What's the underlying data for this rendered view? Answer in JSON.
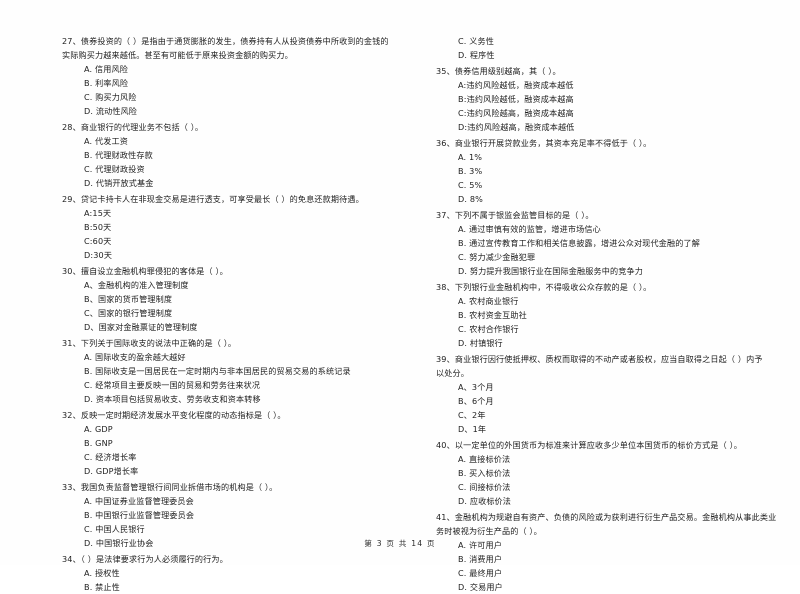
{
  "document": {
    "footer": "第 3 页 共 14 页",
    "page_number": "3",
    "total_pages": "14"
  },
  "columns": [
    {
      "name": "left-column",
      "questions": [
        {
          "number": "27",
          "stem": "27、债券投资的（      ）是指由于通货膨胀的发生，债券持有人从投资债券中所收到的金钱的",
          "stem_cont": "实际购买力越来越低。甚至有可能低于原来投资金额的购买力。",
          "options": [
            "A. 信用风险",
            "B. 利率风险",
            "C. 购买力风险",
            "D. 流动性风险"
          ]
        },
        {
          "number": "28",
          "stem": "28、商业银行的代理业务不包括（      ）。",
          "stem_cont": "",
          "options": [
            "A. 代发工资",
            "B. 代理财政性存款",
            "C. 代理财政投资",
            "D. 代销开放式基金"
          ]
        },
        {
          "number": "29",
          "stem": "29、贷记卡持卡人在非现金交易是进行透支，可享受最长（      ）的免息还款期待遇。",
          "stem_cont": "",
          "options": [
            "A:15天",
            "B:50天",
            "C:60天",
            "D:30天"
          ]
        },
        {
          "number": "30",
          "stem": "30、擅自设立金融机构罪侵犯的客体是（      ）。",
          "stem_cont": "",
          "options": [
            "A、金融机构的准入管理制度",
            "B、国家的货币管理制度",
            "C、国家的银行管理制度",
            "D、国家对金融票证的管理制度"
          ]
        },
        {
          "number": "31",
          "stem": "31、下列关于国际收支的说法中正确的是（      ）。",
          "stem_cont": "",
          "options": [
            "A. 国际收支的盈余越大越好",
            "B. 国际收支是一国居民在一定时期内与非本国居民的贸易交易的系统记录",
            "C. 经常项目主要反映一国的贸易和劳务往来状况",
            "D. 资本项目包括贸易收支、劳务收支和资本转移"
          ]
        },
        {
          "number": "32",
          "stem": "32、反映一定时期经济发展水平变化程度的动态指标是（      ）。",
          "stem_cont": "",
          "options": [
            "A. GDP",
            "B. GNP",
            "C. 经济增长率",
            "D. GDP增长率"
          ]
        },
        {
          "number": "33",
          "stem": "33、我国负责监督管理银行间同业拆借市场的机构是（      ）。",
          "stem_cont": "",
          "options": [
            "A. 中国证券业监督管理委员会",
            "B. 中国银行业监督管理委员会",
            "C. 中国人民银行",
            "D. 中国银行业协会"
          ]
        },
        {
          "number": "34",
          "stem": "34、（      ）是法律要求行为人必须履行的行为。",
          "stem_cont": "",
          "options": [
            "A. 授权性",
            "B. 禁止性"
          ]
        }
      ]
    },
    {
      "name": "right-column",
      "questions": [
        {
          "number": "34-cont",
          "stem": "",
          "stem_cont": "",
          "options": [
            "C. 义务性",
            "D. 程序性"
          ]
        },
        {
          "number": "35",
          "stem": "35、债券信用级别越高，其（      ）。",
          "stem_cont": "",
          "options": [
            "A:违约风险越低，融资成本越低",
            "B:违约风险越低，融资成本越高",
            "C:违约风险越高，融资成本越高",
            "D:违约风险越高，融资成本越低"
          ]
        },
        {
          "number": "36",
          "stem": "36、商业银行开展贷款业务，其资本充足率不得低于（      ）。",
          "stem_cont": "",
          "options": [
            "A. 1%",
            "B. 3%",
            "C. 5%",
            "D. 8%"
          ]
        },
        {
          "number": "37",
          "stem": "37、下列不属于银监会监管目标的是（      ）。",
          "stem_cont": "",
          "options": [
            "A. 通过审慎有效的监管，增进市场信心",
            "B. 通过宣传教育工作和相关信息披露，增进公众对现代金融的了解",
            "C. 努力减少金融犯罪",
            "D. 努力提升我国银行业在国际金融服务中的竞争力"
          ]
        },
        {
          "number": "38",
          "stem": "38、下列银行业金融机构中，不得吸收公众存款的是（      ）。",
          "stem_cont": "",
          "options": [
            "A. 农村商业银行",
            "B. 农村资金互助社",
            "C. 农村合作银行",
            "D. 村镇银行"
          ]
        },
        {
          "number": "39",
          "stem": "39、商业银行因行使抵押权、质权而取得的不动产或者股权，应当自取得之日起（      ）内予",
          "stem_cont": "以处分。",
          "options": [
            "A、3个月",
            "B、6个月",
            "C、2年",
            "D、1年"
          ]
        },
        {
          "number": "40",
          "stem": "40、以一定单位的外国货币为标准来计算应收多少单位本国货币的标价方式是（      ）。",
          "stem_cont": "",
          "options": [
            "A. 直接标价法",
            "B. 买入标价法",
            "C. 间接标价法",
            "D. 应收标价法"
          ]
        },
        {
          "number": "41",
          "stem": "41、金融机构为规避自有资产、负债的风险或为获利进行衍生产品交易。金融机构从事此类业",
          "stem_cont": "务时被视为衍生产品的（      ）。",
          "options": [
            "A. 许可用户",
            "B. 消费用户",
            "C. 最终用户",
            "D. 交易用户"
          ]
        }
      ]
    }
  ]
}
